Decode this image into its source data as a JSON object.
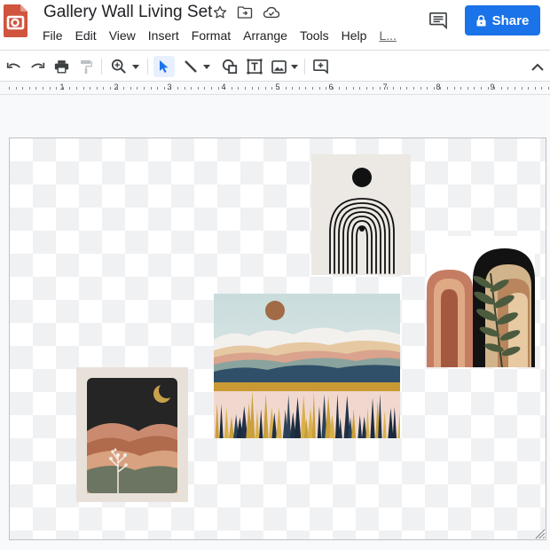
{
  "document": {
    "title": "Gallery Wall Living Set"
  },
  "menu": [
    "File",
    "Edit",
    "View",
    "Insert",
    "Format",
    "Arrange",
    "Tools",
    "Help",
    "L..."
  ],
  "share": {
    "label": "Share"
  },
  "toolbar": [
    "undo-icon",
    "redo-icon",
    "print-icon",
    "paint-format-icon",
    "zoom-icon",
    "select-icon",
    "line-icon",
    "shape-icon",
    "text-box-icon",
    "image-icon",
    "add-comment-icon",
    "collapse-icon"
  ],
  "ruler": {
    "numbers": [
      "1",
      "2",
      "3",
      "4",
      "5",
      "6",
      "7",
      "8",
      "9"
    ]
  },
  "colors": {
    "accent": "#1a73e8",
    "logo": "#d0543e",
    "select_bg": "#e8f0fe"
  },
  "artworks": [
    {
      "name": "black-arch-print"
    },
    {
      "name": "boho-leaf-arches-print"
    },
    {
      "name": "mountain-landscape-print"
    },
    {
      "name": "moon-mountains-print"
    }
  ]
}
